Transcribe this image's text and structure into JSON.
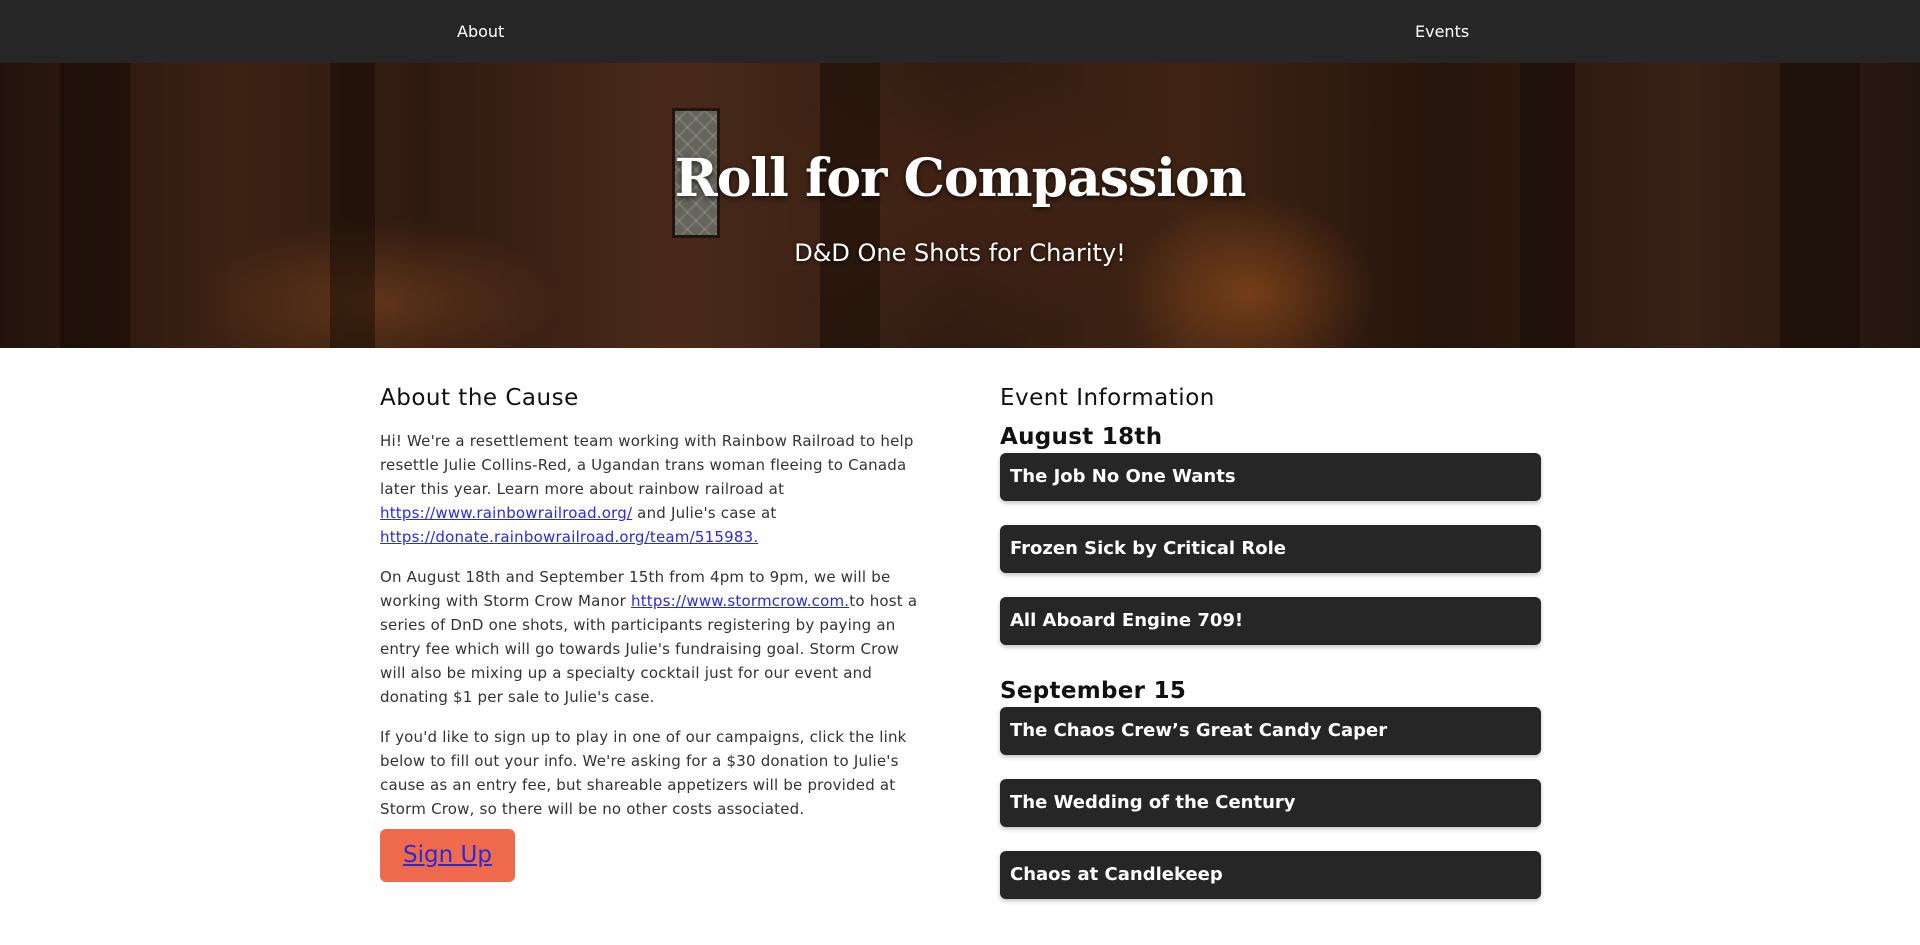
{
  "nav": {
    "about": "About",
    "events": "Events"
  },
  "hero": {
    "title": "Roll for Compassion",
    "subtitle": "D&D One Shots for Charity!"
  },
  "about": {
    "heading": "About the Cause",
    "p1_text_a": "Hi! We're a resettlement team working with Rainbow Railroad to help resettle Julie Collins-Red, a Ugandan trans woman fleeing to Canada later this year. Learn more about rainbow railroad at ",
    "p1_link1": "https://www.rainbowrailroad.org/",
    "p1_text_b": " and Julie's case at ",
    "p1_link2": "https://donate.rainbowrailroad.org/team/515983.",
    "p2_text_a": "On August 18th and September 15th from 4pm to 9pm, we will be working with Storm Crow Manor ",
    "p2_link": "https://www.stormcrow.com.",
    "p2_text_b": "to host a series of DnD one shots, with participants registering by paying an entry fee which will go towards Julie's fundraising goal. Storm Crow will also be mixing up a specialty cocktail just for our event and donating $1 per sale to Julie's case.",
    "p3_text": "If you'd like to sign up to play in one of our campaigns, click the link below to fill out your info. We're asking for a $30 donation to Julie's cause as an entry fee, but shareable appetizers will be provided at Storm Crow, so there will be no other costs associated.",
    "signup_label": "Sign Up"
  },
  "events": {
    "heading": "Event Information",
    "groups": [
      {
        "date": "August 18th",
        "items": [
          "The Job No One Wants",
          "Frozen Sick by Critical Role",
          "All Aboard Engine 709!"
        ]
      },
      {
        "date": "September 15",
        "items": [
          "The Chaos Crew’s Great Candy Caper",
          "The Wedding of the Century",
          "Chaos at Candlekeep"
        ]
      }
    ]
  },
  "colors": {
    "nav_bg": "#262626",
    "accent": "#ef6a4c",
    "link": "#2b2bd6",
    "card_bg": "#262626"
  }
}
